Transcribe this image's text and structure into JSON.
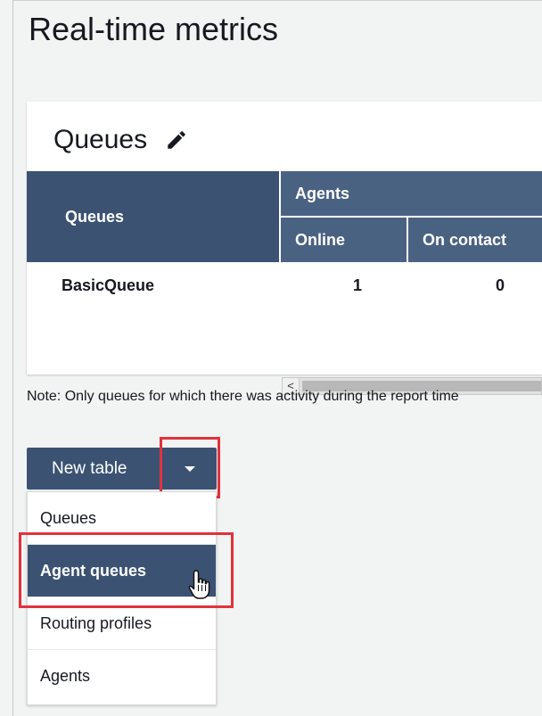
{
  "page": {
    "title": "Real-time metrics"
  },
  "card": {
    "title": "Queues",
    "table": {
      "columns": {
        "queues": "Queues",
        "agents_group": "Agents",
        "online": "Online",
        "on_contact": "On contact"
      },
      "rows": [
        {
          "queue": "BasicQueue",
          "online": "1",
          "on_contact": "0"
        }
      ]
    },
    "scroll_left_glyph": "<"
  },
  "note": "Note: Only queues for which there was activity during the report time",
  "new_table": {
    "label": "New table",
    "menu": [
      "Queues",
      "Agent queues",
      "Routing profiles",
      "Agents"
    ],
    "selected": "Agent queues"
  },
  "colors": {
    "header": "#3b5273",
    "header_light": "#4a6282",
    "highlight": "#e2323c"
  }
}
